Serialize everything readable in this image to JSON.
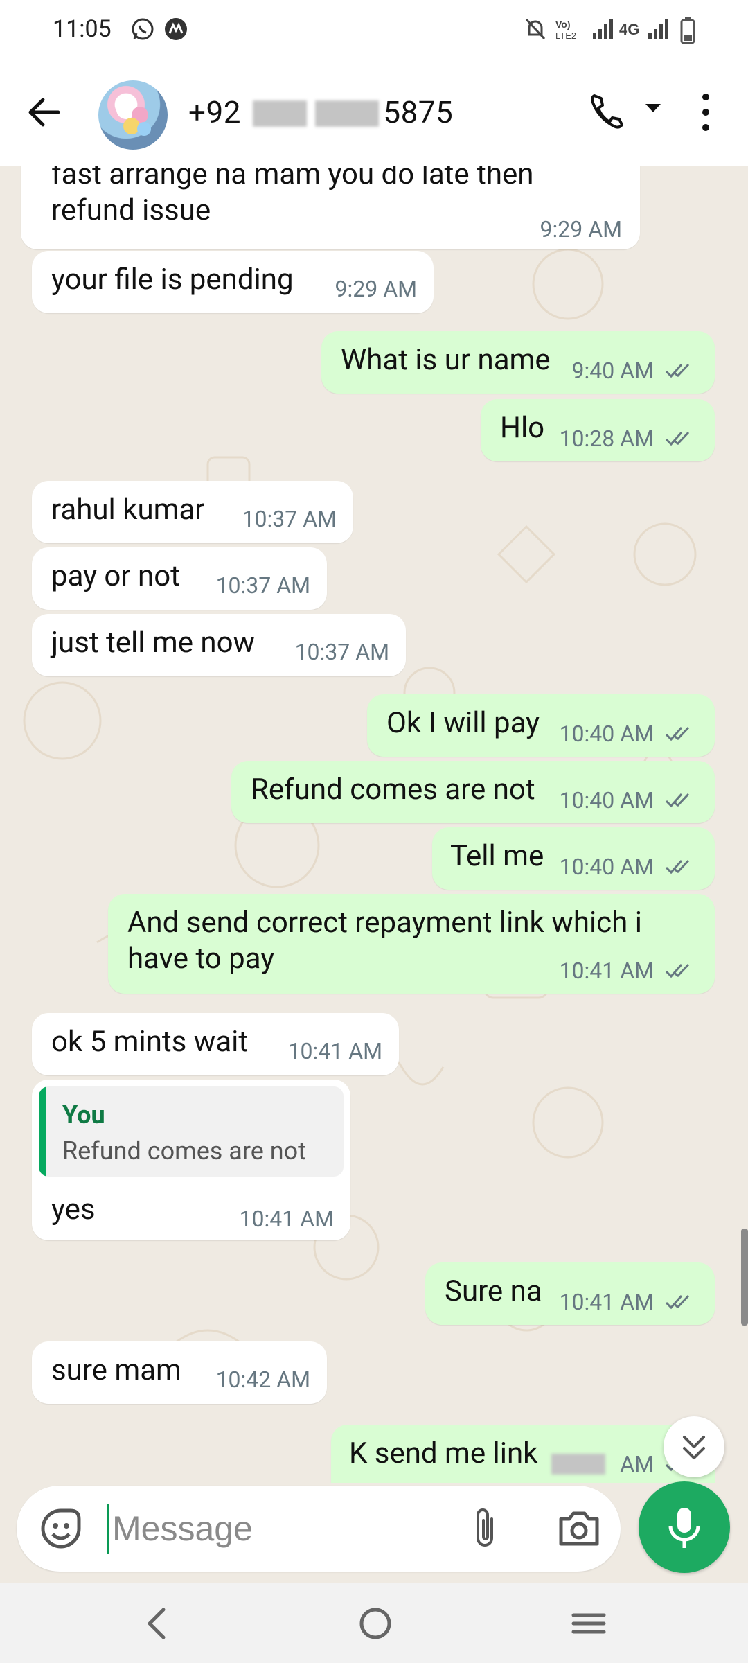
{
  "status_bar": {
    "time": "11:05",
    "icons": [
      "whatsapp-icon",
      "app-notification-icon",
      "mute-icon",
      "volte-icon",
      "signal-icon",
      "4g-icon",
      "signal-icon-2",
      "battery-icon"
    ]
  },
  "header": {
    "contact_prefix": "+92",
    "contact_suffix": "5875",
    "icons": [
      "back-arrow-icon",
      "avatar",
      "call-icon",
      "dropdown-icon",
      "more-options-icon"
    ]
  },
  "messages": [
    {
      "dir": "in",
      "text": "fast arrange na mam you do late then refund issue",
      "time": "9:29 AM"
    },
    {
      "dir": "in",
      "text": "your file is pending",
      "time": "9:29 AM"
    },
    {
      "dir": "out",
      "text": "What is ur name",
      "time": "9:40 AM"
    },
    {
      "dir": "out",
      "text": "Hlo",
      "time": "10:28 AM"
    },
    {
      "dir": "in",
      "text": "rahul kumar",
      "time": "10:37 AM"
    },
    {
      "dir": "in",
      "text": "pay or not",
      "time": "10:37 AM"
    },
    {
      "dir": "in",
      "text": "just tell me now",
      "time": "10:37 AM"
    },
    {
      "dir": "out",
      "text": "Ok I will pay",
      "time": "10:40 AM"
    },
    {
      "dir": "out",
      "text": "Refund comes are not",
      "time": "10:40 AM"
    },
    {
      "dir": "out",
      "text": "Tell me",
      "time": "10:40 AM"
    },
    {
      "dir": "out",
      "text": "And send correct repayment link which i have to pay",
      "time": "10:41 AM"
    },
    {
      "dir": "in",
      "text": "ok 5 mints wait",
      "time": "10:41 AM"
    },
    {
      "dir": "in",
      "text": "yes",
      "time": "10:41 AM",
      "quote": {
        "who": "You",
        "text": "Refund comes are not"
      }
    },
    {
      "dir": "out",
      "text": "Sure na",
      "time": "10:41 AM"
    },
    {
      "dir": "in",
      "text": "sure mam",
      "time": "10:42 AM"
    },
    {
      "dir": "out",
      "text": "K send me link",
      "time": "AM"
    }
  ],
  "composer": {
    "placeholder": "Message",
    "icons": [
      "emoji-icon",
      "attach-icon",
      "camera-icon",
      "mic-icon"
    ]
  },
  "navbar": {
    "icons": [
      "nav-back-icon",
      "nav-home-icon",
      "nav-recents-icon"
    ]
  },
  "colors": {
    "outgoing_bubble": "#d9fdd3",
    "incoming_bubble": "#ffffff",
    "chat_background": "#efeae2",
    "accent": "#1daa61",
    "read_tick": "#667781"
  }
}
